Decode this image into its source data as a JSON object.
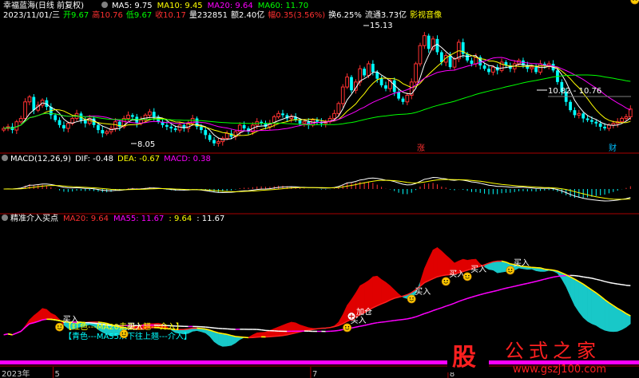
{
  "header": {
    "title": "幸福蓝海(日线 前复权)",
    "ma_items": [
      {
        "label": "MA5: 9.75",
        "color": "#ffffff"
      },
      {
        "label": "MA10: 9.45",
        "color": "#ffff00"
      },
      {
        "label": "MA20: 9.64",
        "color": "#ff00ff"
      },
      {
        "label": "MA60: 11.70",
        "color": "#00ff00"
      }
    ]
  },
  "info_bar": [
    {
      "label": "2023/11/01/三",
      "color": "#ffffff"
    },
    {
      "label": "开9.67",
      "color": "#00ff00"
    },
    {
      "label": "高10.76",
      "color": "#ff3030"
    },
    {
      "label": "低9.67",
      "color": "#00ff00"
    },
    {
      "label": "收10.17",
      "color": "#ff3030"
    },
    {
      "label": "量232851",
      "color": "#ffffff"
    },
    {
      "label": "额2.40亿",
      "color": "#ffffff"
    },
    {
      "label": "幅0.35(3.56%)",
      "color": "#ff3030"
    },
    {
      "label": "换6.25%",
      "color": "#ffffff"
    },
    {
      "label": "流通3.73亿",
      "color": "#ffffff"
    },
    {
      "label": "影视音像",
      "color": "#ffff00"
    }
  ],
  "price_labels": {
    "high": "15.13",
    "low": "8.05",
    "range": "10.82 - 10.76"
  },
  "badges": {
    "rise": "涨",
    "wealth": "财"
  },
  "macd_header": [
    {
      "label": "MACD(12,26,9)",
      "color": "#ffffff"
    },
    {
      "label": "DIF: -0.48",
      "color": "#ffffff"
    },
    {
      "label": "DEA: -0.67",
      "color": "#ffff00"
    },
    {
      "label": "MACD: 0.38",
      "color": "#ff00ff"
    }
  ],
  "ind_header": [
    {
      "label": "精准介入买点",
      "color": "#ffffff"
    },
    {
      "label": "MA20: 9.64",
      "color": "#ff3030"
    },
    {
      "label": "MA55: 11.67",
      "color": "#ff00ff"
    },
    {
      "label": ": 9.64",
      "color": "#ffff00"
    },
    {
      "label": ": 11.67",
      "color": "#ffffff"
    }
  ],
  "legend": {
    "red": "【红色---MA20走平上翘---介入】",
    "cyan": "【青色---MA55从下往上翘---介入】"
  },
  "signals": {
    "enter": "买入",
    "add": "加仓"
  },
  "timeline": {
    "year": "2023年",
    "ticks": [
      "5",
      "7",
      "8"
    ]
  },
  "watermark": {
    "mark": "股",
    "text": "公式之家",
    "url": "www.gszj100.com"
  },
  "chart_data": {
    "type": "candlestick",
    "title": "幸福蓝海(日线 前复权)",
    "x_start": "2023年",
    "month_ticks": [
      "5",
      "7",
      "8"
    ],
    "annotated_high": 15.13,
    "annotated_low": 8.05,
    "last_bar": {
      "date": "2023/11/01",
      "open": 9.67,
      "high": 10.76,
      "low": 9.67,
      "close": 10.17,
      "volume": 232851
    },
    "close": [
      9.0,
      9.1,
      8.9,
      9.4,
      9.6,
      10.6,
      10.9,
      10.1,
      10.4,
      10.7,
      10.3,
      9.8,
      9.5,
      9.2,
      9.0,
      9.3,
      9.6,
      9.9,
      9.5,
      9.3,
      9.6,
      9.2,
      8.9,
      8.7,
      8.8,
      9.0,
      9.4,
      9.1,
      9.6,
      9.8,
      9.7,
      9.3,
      9.5,
      9.8,
      10.0,
      9.7,
      9.4,
      9.2,
      9.1,
      9.0,
      8.9,
      9.2,
      9.0,
      9.3,
      9.6,
      9.1,
      8.9,
      8.6,
      8.3,
      8.1,
      8.2,
      8.4,
      8.7,
      8.5,
      8.8,
      9.2,
      9.0,
      8.8,
      9.2,
      9.4,
      9.3,
      9.1,
      9.3,
      9.7,
      9.9,
      9.8,
      9.6,
      9.7,
      9.5,
      9.3,
      9.4,
      9.2,
      9.5,
      9.4,
      9.3,
      9.4,
      9.6,
      9.9,
      10.5,
      11.5,
      12.1,
      11.3,
      11.8,
      12.6,
      12.2,
      12.9,
      12.4,
      12.0,
      11.6,
      11.4,
      11.9,
      11.2,
      10.8,
      10.6,
      11.0,
      11.8,
      12.9,
      14.0,
      14.6,
      13.8,
      14.4,
      13.6,
      13.0,
      13.4,
      12.7,
      13.2,
      14.2,
      13.5,
      13.1,
      12.9,
      13.3,
      12.8,
      12.6,
      12.4,
      12.7,
      12.5,
      13.0,
      12.8,
      12.6,
      12.9,
      13.1,
      12.8,
      12.6,
      12.7,
      12.4,
      12.9,
      12.8,
      12.9,
      12.5,
      11.8,
      11.2,
      10.6,
      10.1,
      9.8,
      9.9,
      9.6,
      9.5,
      9.4,
      9.3,
      9.1,
      9.0,
      9.2,
      9.3,
      9.4,
      9.6,
      9.7,
      10.17
    ],
    "series": [
      {
        "name": "MA5",
        "last": 9.75,
        "color": "#ffffff"
      },
      {
        "name": "MA10",
        "last": 9.45,
        "color": "#ffff00"
      },
      {
        "name": "MA20",
        "last": 9.64,
        "color": "#ff00ff"
      },
      {
        "name": "MA60",
        "last": 11.7,
        "color": "#00ff00"
      }
    ],
    "macd": {
      "name": "MACD(12,26,9)",
      "dif": -0.48,
      "dea": -0.67,
      "macd": 0.38
    },
    "indicator": {
      "name": "精准介入买点",
      "ma20": 9.64,
      "ma55": 11.67
    }
  }
}
